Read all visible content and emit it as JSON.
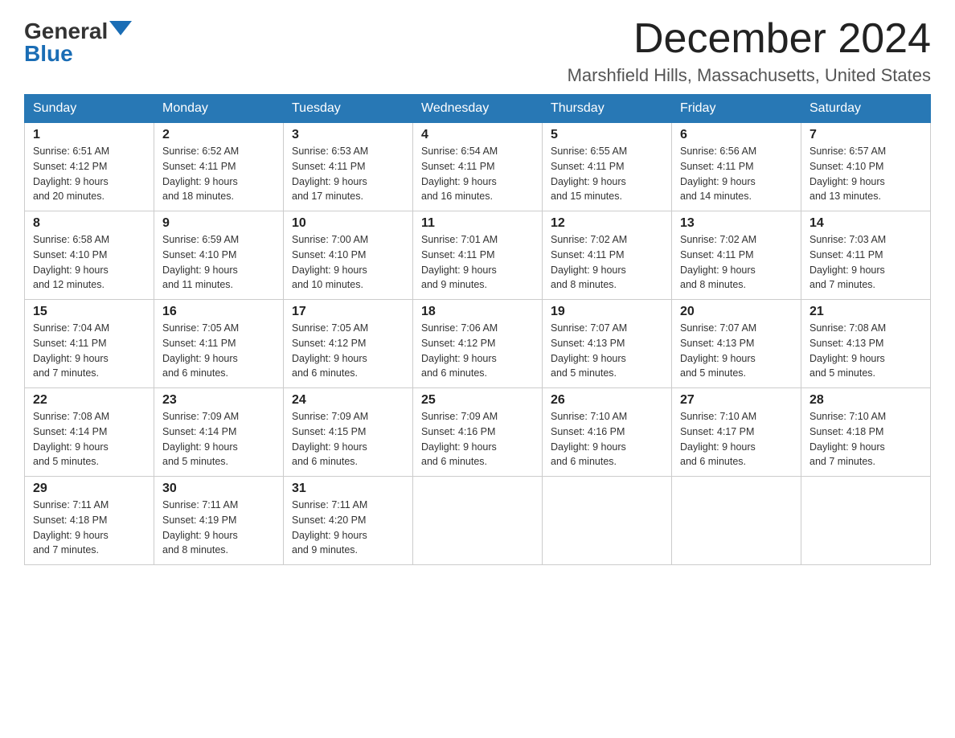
{
  "logo": {
    "general": "General",
    "blue": "Blue"
  },
  "title": {
    "month_year": "December 2024",
    "location": "Marshfield Hills, Massachusetts, United States"
  },
  "days_of_week": [
    "Sunday",
    "Monday",
    "Tuesday",
    "Wednesday",
    "Thursday",
    "Friday",
    "Saturday"
  ],
  "weeks": [
    [
      {
        "num": "1",
        "sunrise": "6:51 AM",
        "sunset": "4:12 PM",
        "daylight": "9 hours and 20 minutes."
      },
      {
        "num": "2",
        "sunrise": "6:52 AM",
        "sunset": "4:11 PM",
        "daylight": "9 hours and 18 minutes."
      },
      {
        "num": "3",
        "sunrise": "6:53 AM",
        "sunset": "4:11 PM",
        "daylight": "9 hours and 17 minutes."
      },
      {
        "num": "4",
        "sunrise": "6:54 AM",
        "sunset": "4:11 PM",
        "daylight": "9 hours and 16 minutes."
      },
      {
        "num": "5",
        "sunrise": "6:55 AM",
        "sunset": "4:11 PM",
        "daylight": "9 hours and 15 minutes."
      },
      {
        "num": "6",
        "sunrise": "6:56 AM",
        "sunset": "4:11 PM",
        "daylight": "9 hours and 14 minutes."
      },
      {
        "num": "7",
        "sunrise": "6:57 AM",
        "sunset": "4:10 PM",
        "daylight": "9 hours and 13 minutes."
      }
    ],
    [
      {
        "num": "8",
        "sunrise": "6:58 AM",
        "sunset": "4:10 PM",
        "daylight": "9 hours and 12 minutes."
      },
      {
        "num": "9",
        "sunrise": "6:59 AM",
        "sunset": "4:10 PM",
        "daylight": "9 hours and 11 minutes."
      },
      {
        "num": "10",
        "sunrise": "7:00 AM",
        "sunset": "4:10 PM",
        "daylight": "9 hours and 10 minutes."
      },
      {
        "num": "11",
        "sunrise": "7:01 AM",
        "sunset": "4:11 PM",
        "daylight": "9 hours and 9 minutes."
      },
      {
        "num": "12",
        "sunrise": "7:02 AM",
        "sunset": "4:11 PM",
        "daylight": "9 hours and 8 minutes."
      },
      {
        "num": "13",
        "sunrise": "7:02 AM",
        "sunset": "4:11 PM",
        "daylight": "9 hours and 8 minutes."
      },
      {
        "num": "14",
        "sunrise": "7:03 AM",
        "sunset": "4:11 PM",
        "daylight": "9 hours and 7 minutes."
      }
    ],
    [
      {
        "num": "15",
        "sunrise": "7:04 AM",
        "sunset": "4:11 PM",
        "daylight": "9 hours and 7 minutes."
      },
      {
        "num": "16",
        "sunrise": "7:05 AM",
        "sunset": "4:11 PM",
        "daylight": "9 hours and 6 minutes."
      },
      {
        "num": "17",
        "sunrise": "7:05 AM",
        "sunset": "4:12 PM",
        "daylight": "9 hours and 6 minutes."
      },
      {
        "num": "18",
        "sunrise": "7:06 AM",
        "sunset": "4:12 PM",
        "daylight": "9 hours and 6 minutes."
      },
      {
        "num": "19",
        "sunrise": "7:07 AM",
        "sunset": "4:13 PM",
        "daylight": "9 hours and 5 minutes."
      },
      {
        "num": "20",
        "sunrise": "7:07 AM",
        "sunset": "4:13 PM",
        "daylight": "9 hours and 5 minutes."
      },
      {
        "num": "21",
        "sunrise": "7:08 AM",
        "sunset": "4:13 PM",
        "daylight": "9 hours and 5 minutes."
      }
    ],
    [
      {
        "num": "22",
        "sunrise": "7:08 AM",
        "sunset": "4:14 PM",
        "daylight": "9 hours and 5 minutes."
      },
      {
        "num": "23",
        "sunrise": "7:09 AM",
        "sunset": "4:14 PM",
        "daylight": "9 hours and 5 minutes."
      },
      {
        "num": "24",
        "sunrise": "7:09 AM",
        "sunset": "4:15 PM",
        "daylight": "9 hours and 6 minutes."
      },
      {
        "num": "25",
        "sunrise": "7:09 AM",
        "sunset": "4:16 PM",
        "daylight": "9 hours and 6 minutes."
      },
      {
        "num": "26",
        "sunrise": "7:10 AM",
        "sunset": "4:16 PM",
        "daylight": "9 hours and 6 minutes."
      },
      {
        "num": "27",
        "sunrise": "7:10 AM",
        "sunset": "4:17 PM",
        "daylight": "9 hours and 6 minutes."
      },
      {
        "num": "28",
        "sunrise": "7:10 AM",
        "sunset": "4:18 PM",
        "daylight": "9 hours and 7 minutes."
      }
    ],
    [
      {
        "num": "29",
        "sunrise": "7:11 AM",
        "sunset": "4:18 PM",
        "daylight": "9 hours and 7 minutes."
      },
      {
        "num": "30",
        "sunrise": "7:11 AM",
        "sunset": "4:19 PM",
        "daylight": "9 hours and 8 minutes."
      },
      {
        "num": "31",
        "sunrise": "7:11 AM",
        "sunset": "4:20 PM",
        "daylight": "9 hours and 9 minutes."
      },
      null,
      null,
      null,
      null
    ]
  ],
  "labels": {
    "sunrise": "Sunrise:",
    "sunset": "Sunset:",
    "daylight": "Daylight:"
  }
}
